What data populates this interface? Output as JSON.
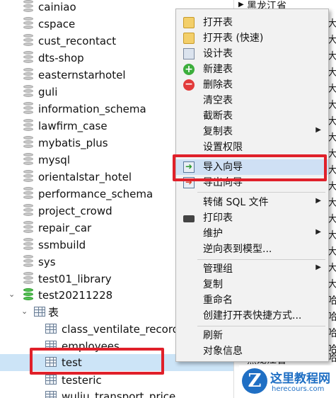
{
  "tree": {
    "databases": [
      {
        "name": "cainiao"
      },
      {
        "name": "cspace"
      },
      {
        "name": "cust_recontact"
      },
      {
        "name": "dts-shop"
      },
      {
        "name": "easternstarhotel"
      },
      {
        "name": "guli"
      },
      {
        "name": "information_schema"
      },
      {
        "name": "lawfirm_case"
      },
      {
        "name": "mybatis_plus"
      },
      {
        "name": "mysql"
      },
      {
        "name": "orientalstar_hotel"
      },
      {
        "name": "performance_schema"
      },
      {
        "name": "project_crowd"
      },
      {
        "name": "repair_car"
      },
      {
        "name": "ssmbuild"
      },
      {
        "name": "sys"
      },
      {
        "name": "test01_library"
      },
      {
        "name": "test20211228"
      }
    ],
    "tables_folder": "表",
    "tables": [
      {
        "name": "class_ventilate_record"
      },
      {
        "name": "employees"
      },
      {
        "name": "test"
      },
      {
        "name": "testeric"
      },
      {
        "name": "wuliu_transport_price"
      }
    ]
  },
  "right_column": {
    "top_cell": "黑龙江省",
    "cells": [
      "大",
      "大",
      "大",
      "大",
      "大",
      "大",
      "大",
      "大",
      "大",
      "大",
      "大",
      "大",
      "大",
      "大",
      "大",
      "大",
      "大",
      "哈",
      "哈",
      "哈",
      "哈",
      "哈"
    ],
    "bottom_cell": "黑龙江省"
  },
  "context_menu": {
    "items": [
      {
        "label": "打开表",
        "icon": "open-table-icon"
      },
      {
        "label": "打开表 (快速)",
        "icon": "open-table-fast-icon"
      },
      {
        "label": "设计表",
        "icon": "design-table-icon"
      },
      {
        "label": "新建表",
        "icon": "new-table-icon"
      },
      {
        "label": "删除表",
        "icon": "delete-table-icon"
      },
      {
        "label": "清空表"
      },
      {
        "label": "截断表"
      },
      {
        "label": "复制表",
        "submenu": true
      },
      {
        "label": "设置权限"
      },
      {
        "label": "导入向导",
        "icon": "import-wizard-icon",
        "highlighted": true
      },
      {
        "label": "导出向导",
        "icon": "export-wizard-icon"
      },
      {
        "label": "转储 SQL 文件",
        "submenu": true
      },
      {
        "label": "打印表",
        "icon": "printer-icon"
      },
      {
        "label": "维护",
        "submenu": true
      },
      {
        "label": "逆向表到模型..."
      },
      {
        "label": "管理组",
        "submenu": true
      },
      {
        "label": "复制"
      },
      {
        "label": "重命名"
      },
      {
        "label": "创建打开表快捷方式..."
      },
      {
        "label": "刷新"
      },
      {
        "label": "对象信息"
      }
    ],
    "submenu_arrow": "▶"
  },
  "watermark": {
    "logo_letter": "Z",
    "title": "这里教程网",
    "url": "herecours.com"
  },
  "colors": {
    "highlight_box": "#e0202a",
    "selection": "#cce4f7",
    "menu_bg": "#f2f2f2",
    "menu_highlight": "#cfe0f4",
    "watermark_blue": "#1f6fc4"
  }
}
